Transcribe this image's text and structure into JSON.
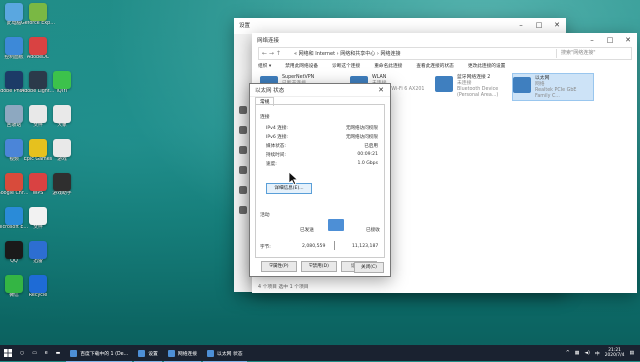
{
  "desktop_icons": [
    {
      "label": "此电脑",
      "color": "#5aa7e0"
    },
    {
      "label": "Geforce Experience",
      "color": "#7ab844"
    },
    {
      "label": "控制面板",
      "color": "#3d89d8"
    },
    {
      "label": "AdobeDC",
      "color": "#d94242"
    },
    {
      "label": "Adobe Photoshop",
      "color": "#1c3b67"
    },
    {
      "label": "Adobe Lightroom",
      "color": "#2b3a4a"
    },
    {
      "label": "iQIYI",
      "color": "#3cc24b"
    },
    {
      "label": "回收站",
      "color": "#8da8c0"
    },
    {
      "label": "文件",
      "color": "#e8e8e8"
    },
    {
      "label": "大象",
      "color": "#e9e9e9"
    },
    {
      "label": "视频",
      "color": "#4b85d8"
    },
    {
      "label": "Epic Games",
      "color": "#e6c11e"
    },
    {
      "label": "游戏",
      "color": "#e9e9e9"
    },
    {
      "label": "Google Chrome",
      "color": "#d84b3b"
    },
    {
      "label": "WPS",
      "color": "#d94242"
    },
    {
      "label": "游戏助手",
      "color": "#2f2f2f"
    },
    {
      "label": "Microsoft Edge",
      "color": "#2a8bd8"
    },
    {
      "label": "文件",
      "color": "#f2f2f2"
    },
    {
      "label": "QQ",
      "color": "#1a1a1a"
    },
    {
      "label": "迅雷",
      "color": "#2d6ed1"
    },
    {
      "label": "微信",
      "color": "#34b544"
    },
    {
      "label": "Recycle",
      "color": "#1e6bd6"
    }
  ],
  "settings_window": {
    "title": "设置"
  },
  "netconn_window": {
    "title": "网络连接",
    "breadcrumb": "« 网络和 Internet › 网络和共享中心 › 网络连接",
    "search_placeholder": "搜索\"网络连接\"",
    "commands": [
      "组织 ▾",
      "禁用此网络设备",
      "诊断这个连接",
      "重命名此连接",
      "查看此连接的状态",
      "更改此连接的设置"
    ],
    "adapters": [
      {
        "name": "SuperNetVPN",
        "status": "已断开连接",
        "device": "Remote Access"
      },
      {
        "name": "WLAN",
        "status": "未连接",
        "device": "Intel(R) Wi-Fi 6 AX201"
      },
      {
        "name": "蓝牙网络连接 2",
        "status": "未连接",
        "device": "Bluetooth Device (Personal Area...)"
      },
      {
        "name": "以太网",
        "status": "网络",
        "device": "Realtek PCIe GbE Family C..."
      }
    ],
    "status_text": "4 个项目    选中 1 个项目"
  },
  "dialog": {
    "title": "以太网 状态",
    "tab": "常规",
    "section_connection": "连接",
    "rows": [
      {
        "label": "IPv4 连接:",
        "value": "无网络访问权限"
      },
      {
        "label": "IPv6 连接:",
        "value": "无网络访问权限"
      },
      {
        "label": "媒体状态:",
        "value": "已启用"
      },
      {
        "label": "持续时间:",
        "value": "00:09:21"
      },
      {
        "label": "速度:",
        "value": "1.0 Gbps"
      }
    ],
    "details_button": "详细信息(E)...",
    "section_activity": "活动",
    "sent_label": "已发送",
    "recv_label": "已接收",
    "bytes_label": "字节:",
    "bytes_sent": "2,080,559",
    "bytes_recv": "11,123,187",
    "properties_button": "属性(P)",
    "disable_button": "禁用(D)",
    "diagnose_button": "诊断(G)",
    "close_button": "关闭(C)"
  },
  "taskbar": {
    "apps": [
      "百度下载中的 1 (De...",
      "设置",
      "网络连接",
      "以太网 状态"
    ],
    "clock_time": "21:21",
    "clock_date": "2020/7/4"
  }
}
